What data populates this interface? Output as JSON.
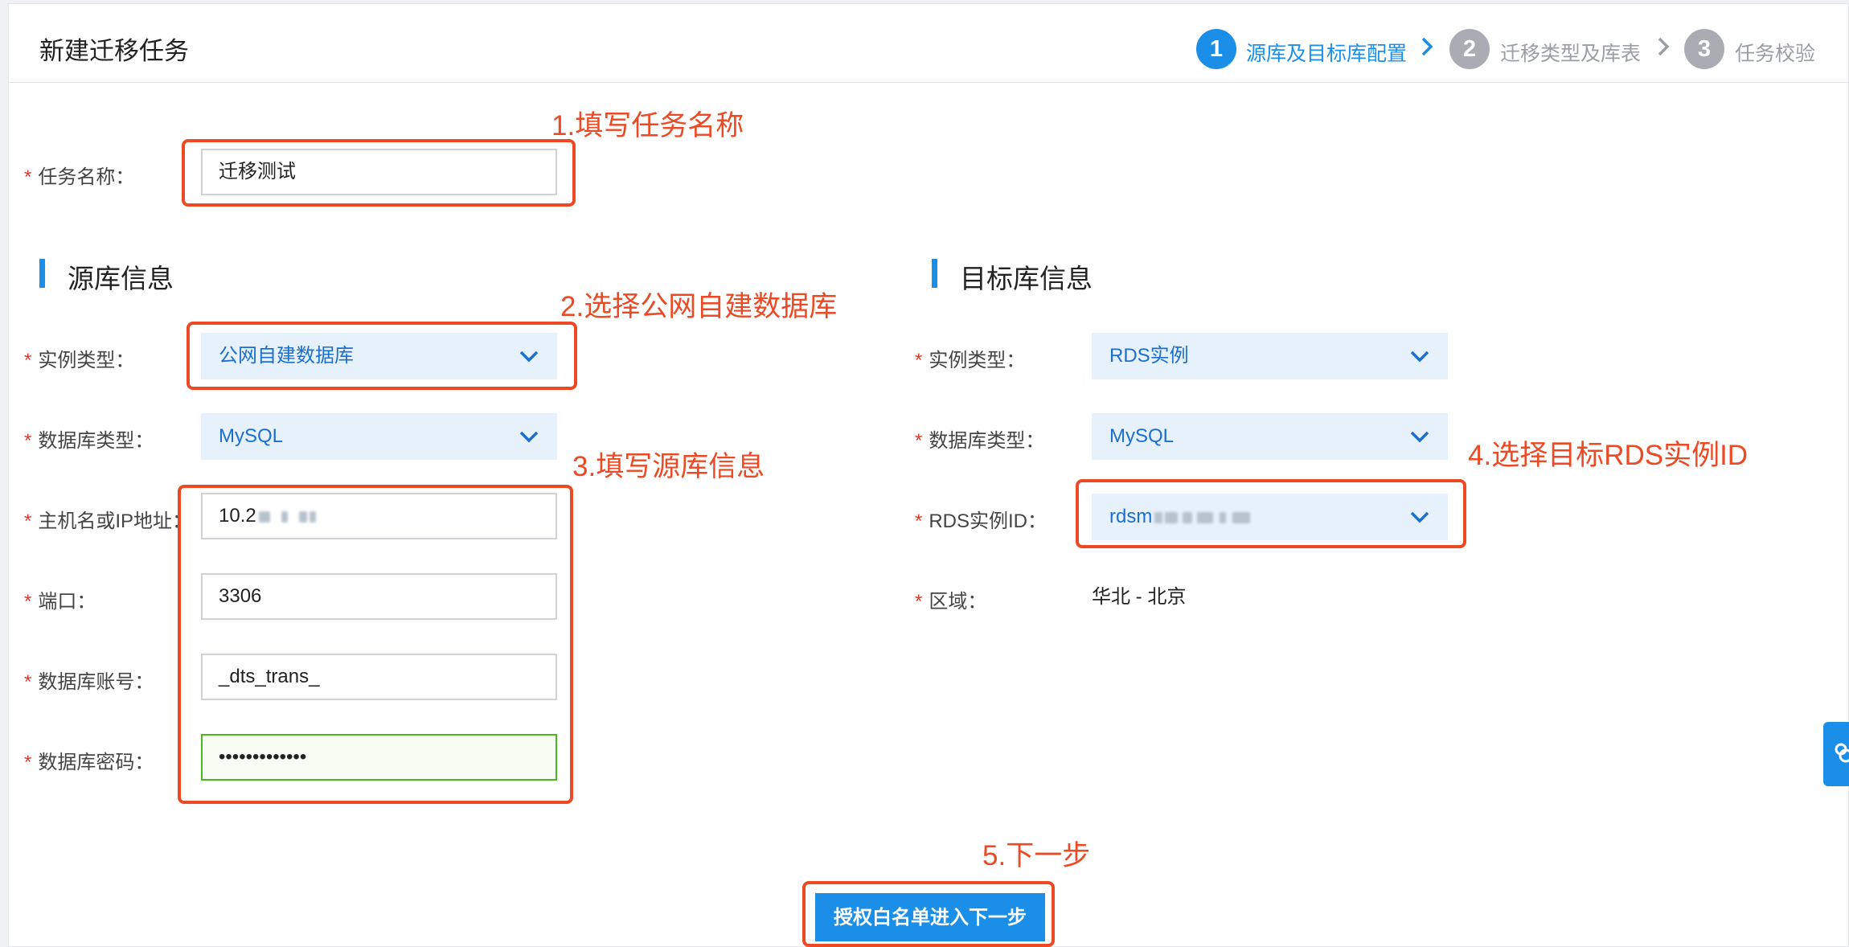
{
  "header": {
    "title": "新建迁移任务"
  },
  "steps": [
    {
      "num": "1",
      "label": "源库及目标库配置"
    },
    {
      "num": "2",
      "label": "迁移类型及库表"
    },
    {
      "num": "3",
      "label": "任务校验"
    }
  ],
  "task": {
    "label": "任务名称：",
    "value": "迁移测试"
  },
  "source": {
    "title": "源库信息",
    "instance_type": {
      "label": "实例类型：",
      "value": "公网自建数据库"
    },
    "db_type": {
      "label": "数据库类型：",
      "value": "MySQL"
    },
    "host": {
      "label": "主机名或IP地址：",
      "value": "10.2"
    },
    "port": {
      "label": "端口：",
      "value": "3306"
    },
    "account": {
      "label": "数据库账号：",
      "value": "_dts_trans_"
    },
    "password": {
      "label": "数据库密码：",
      "value": "•••••••••••••"
    }
  },
  "target": {
    "title": "目标库信息",
    "instance_type": {
      "label": "实例类型：",
      "value": "RDS实例"
    },
    "db_type": {
      "label": "数据库类型：",
      "value": "MySQL"
    },
    "rds_id": {
      "label": "RDS实例ID：",
      "value": "rdsm"
    },
    "region": {
      "label": "区域：",
      "value": "华北 - 北京"
    }
  },
  "annotations": {
    "a1": "1.填写任务名称",
    "a2": "2.选择公网自建数据库",
    "a3": "3.填写源库信息",
    "a4": "4.选择目标RDS实例ID",
    "a5": "5.下一步"
  },
  "footer": {
    "next_label": "授权白名单进入下一步"
  },
  "required_mark": "*",
  "colors": {
    "accent": "#1b8fe8",
    "annotation": "#eb4a24",
    "focus_border": "#49b81e"
  }
}
